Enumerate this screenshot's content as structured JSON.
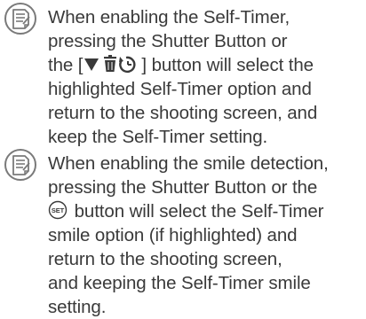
{
  "notes": [
    {
      "icon": "note-memo-icon",
      "lines": [
        "When enabling the Self-Timer,",
        "pressing the Shutter Button or",
        "the [",
        "] button will select the",
        "highlighted Self-Timer option and",
        "return to the shooting screen, and",
        "keep the Self-Timer setting."
      ]
    },
    {
      "icon": "note-memo-icon",
      "lines": [
        "When enabling the smile detection,",
        "pressing the Shutter Button or the",
        "SET",
        " button will select the Self-Timer",
        "smile option (if highlighted) and",
        "return to the shooting screen,",
        "and keeping the Self-Timer smile",
        "setting."
      ]
    }
  ],
  "colors": {
    "text": "#3a3a3a",
    "icon": "#7a7a7a"
  }
}
